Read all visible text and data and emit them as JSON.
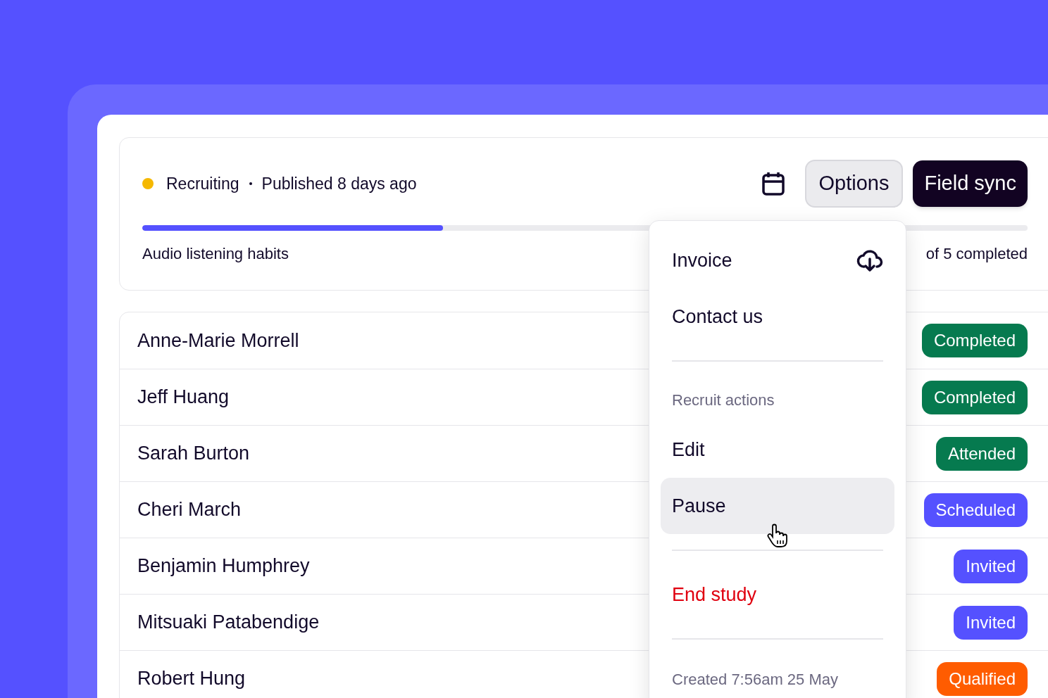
{
  "study": {
    "status": "Recruiting",
    "published": "Published 8 days ago",
    "name": "Audio listening habits",
    "progress_text": "of 5 completed",
    "level": 0.34
  },
  "buttons": [
    {
      "label": "Options",
      "kind": "secondary"
    },
    {
      "label": "Field sync",
      "kind": "primary"
    }
  ],
  "participants": [
    {
      "name": "Anne-Marie Morrell",
      "status": "Completed",
      "color": "#067a4f"
    },
    {
      "name": "Jeff Huang",
      "status": "Completed",
      "color": "#067a4f"
    },
    {
      "name": "Sarah Burton",
      "status": "Attended",
      "color": "#067a4f"
    },
    {
      "name": "Cheri March",
      "status": "Scheduled",
      "color": "#5551ff"
    },
    {
      "name": "Benjamin Humphrey",
      "status": "Invited",
      "color": "#5551ff"
    },
    {
      "name": "Mitsuaki Patabendige",
      "status": "Invited",
      "color": "#5551ff"
    },
    {
      "name": "Robert Hung",
      "status": "Qualified",
      "color": "#ff5c00"
    }
  ],
  "menu": {
    "items": [
      {
        "kind": "icon_item",
        "label": "Invoice",
        "highlighted": false
      },
      {
        "kind": "item",
        "label": "Contact us",
        "highlighted": false
      },
      {
        "kind": "divider"
      },
      {
        "kind": "heading",
        "label": "Recruit actions"
      },
      {
        "kind": "item",
        "label": "Edit",
        "highlighted": false
      },
      {
        "kind": "item",
        "label": "Pause",
        "highlighted": true
      },
      {
        "kind": "divider"
      },
      {
        "kind": "danger",
        "label": "End study",
        "highlighted": false
      },
      {
        "kind": "divider"
      }
    ],
    "footer": "Created 7:56am 25 May"
  }
}
